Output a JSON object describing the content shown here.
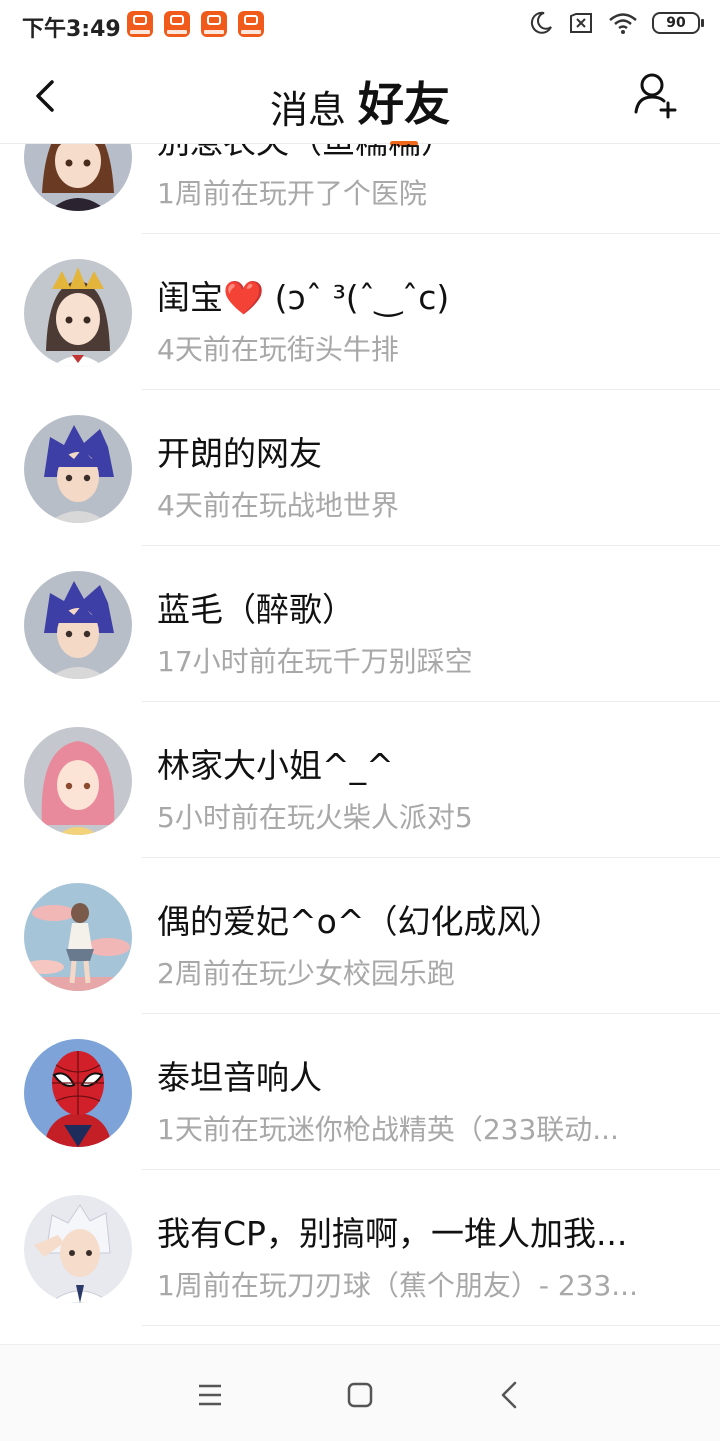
{
  "status_bar": {
    "time": "下午3:49",
    "battery": "90",
    "icons": [
      "app-notification-icon",
      "app-notification-icon",
      "app-notification-icon",
      "app-notification-icon",
      "moon-icon",
      "sim-off-icon",
      "wifi-icon",
      "battery-icon"
    ]
  },
  "header": {
    "tab_messages": "消息",
    "tab_friends": "好友",
    "accent_color": "#f06a1d"
  },
  "friends": [
    {
      "name": "别惹农夫（鱼糯糯）",
      "status": "1周前在玩开了个医院",
      "avatar": "girl-brown-hair"
    },
    {
      "name": "闺宝❤️ (ɔˆ ³(ˆ‿ˆc)",
      "status": "4天前在玩街头牛排",
      "avatar": "girl-gold-headdress"
    },
    {
      "name": "开朗的网友",
      "status": "4天前在玩战地世界",
      "avatar": "boy-purple-hair"
    },
    {
      "name": "蓝毛（醉歌）",
      "status": "17小时前在玩千万别踩空",
      "avatar": "boy-purple-hair"
    },
    {
      "name": "林家大小姐^_^",
      "status": "5小时前在玩火柴人派对5",
      "avatar": "girl-pink-hair"
    },
    {
      "name": "偶的爱妃^o^（幻化成风）",
      "status": "2周前在玩少女校园乐跑",
      "avatar": "girl-pastel-sky"
    },
    {
      "name": "泰坦音响人",
      "status": "1天前在玩迷你枪战精英（233联动...",
      "avatar": "spider-mask"
    },
    {
      "name": "我有CP，别搞啊，一堆人加我...",
      "status": "1周前在玩刀刃球（蕉个朋友）- 233...",
      "avatar": "boy-white-hair-salute"
    }
  ]
}
